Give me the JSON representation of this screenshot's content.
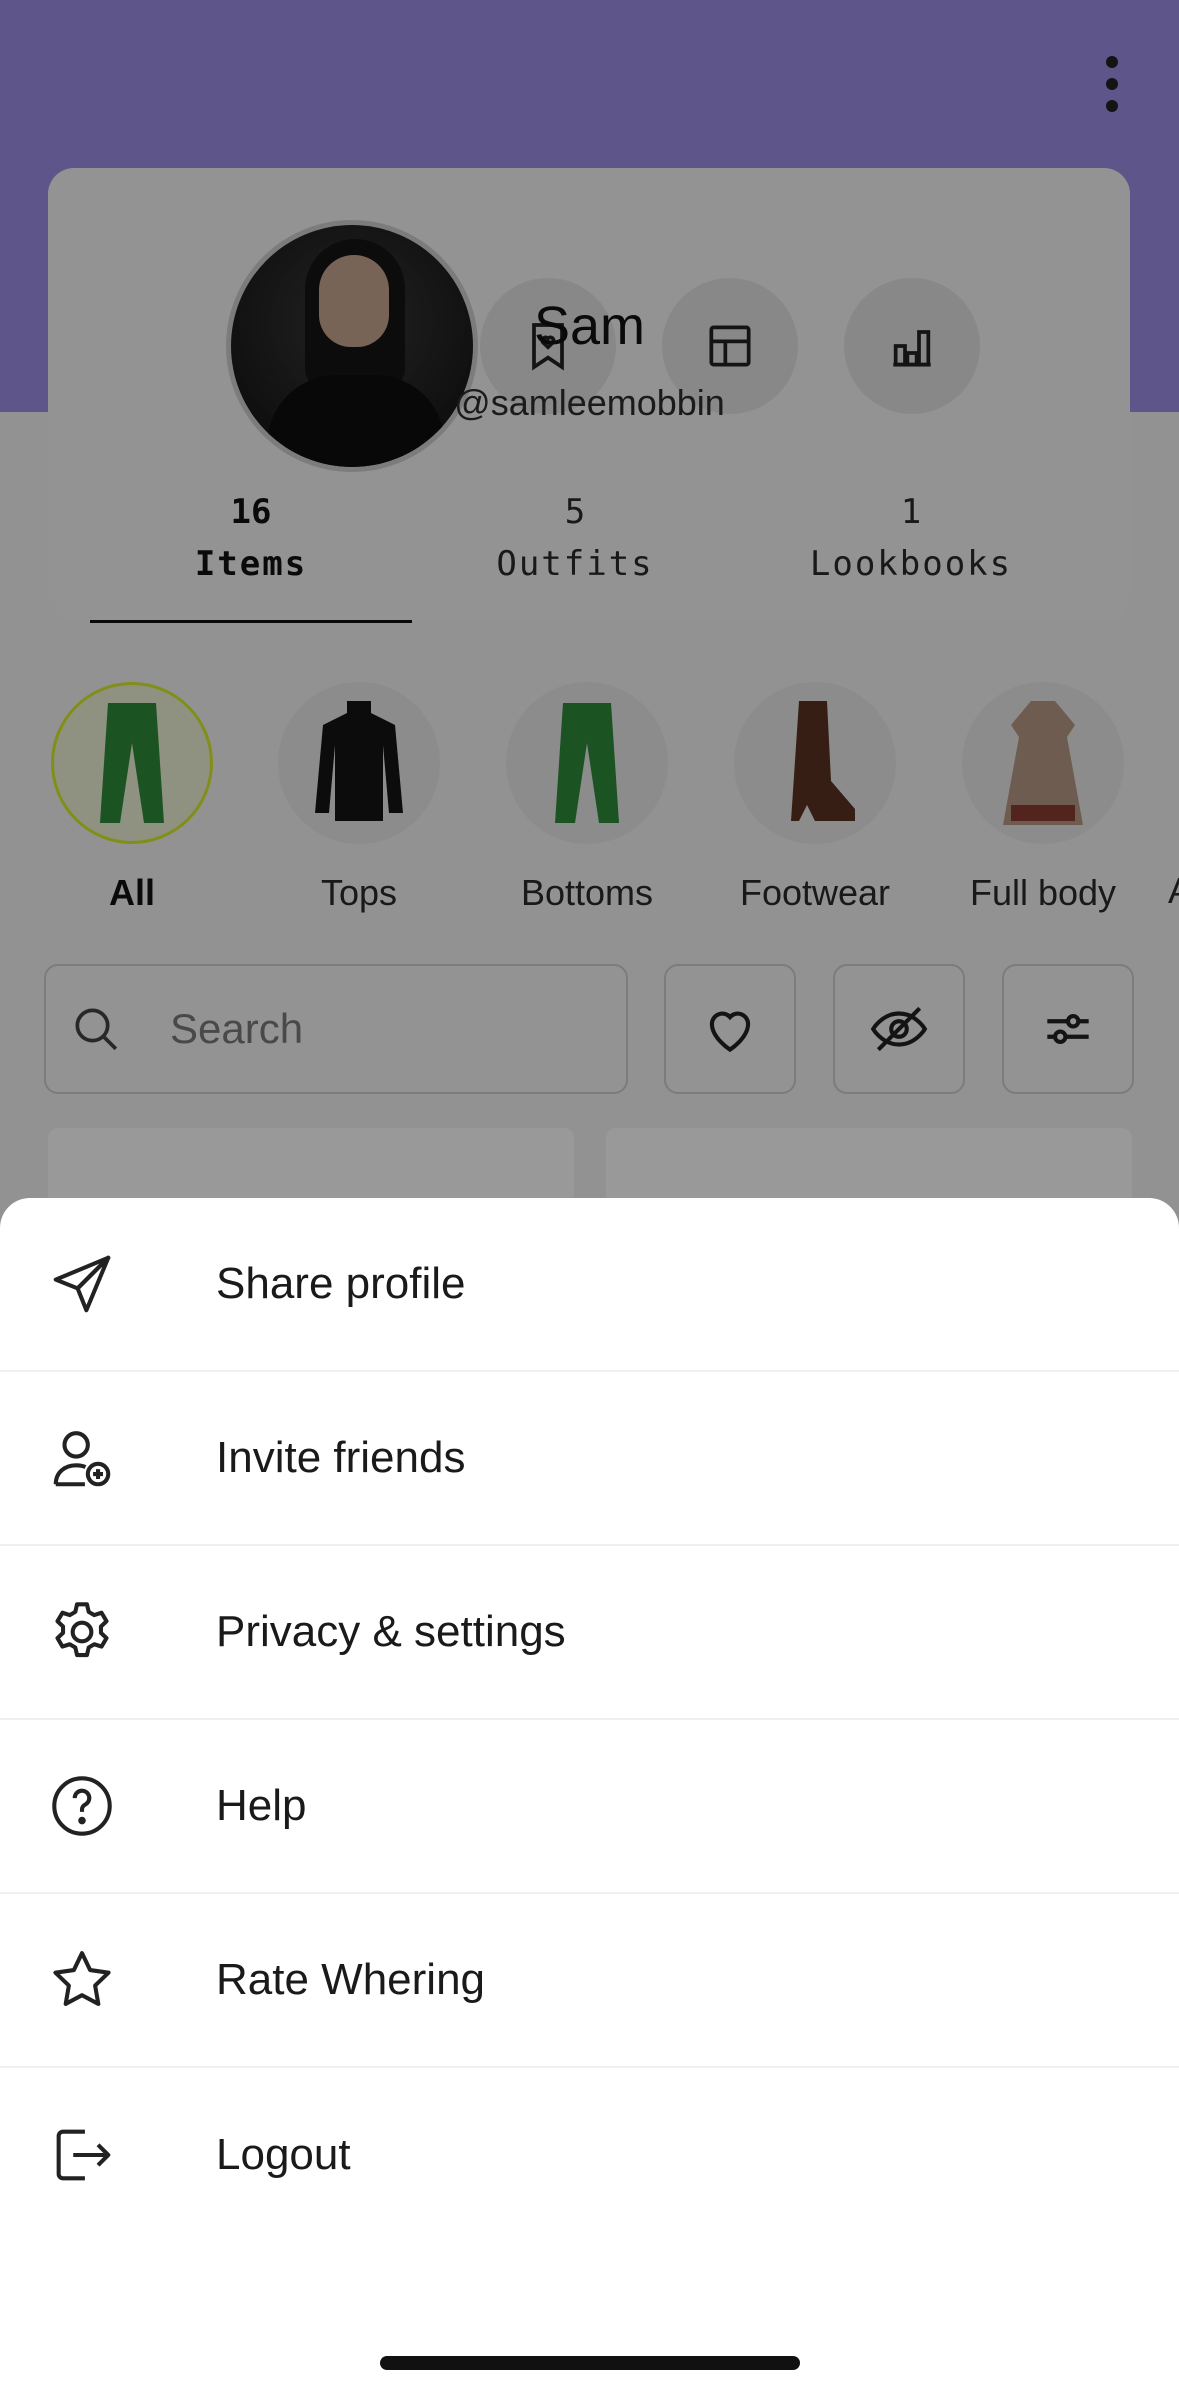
{
  "profile": {
    "name": "Sam",
    "handle": "@samleemobbin",
    "icons": [
      "bookmark-heart-icon",
      "layout-grid-icon",
      "bar-chart-icon",
      "more-vertical-icon"
    ]
  },
  "stats": [
    {
      "count": "16",
      "label": "Items",
      "active": true
    },
    {
      "count": "5",
      "label": "Outfits",
      "active": false
    },
    {
      "count": "1",
      "label": "Lookbooks",
      "active": false
    }
  ],
  "categories": [
    {
      "label": "All",
      "selected": true
    },
    {
      "label": "Tops",
      "selected": false
    },
    {
      "label": "Bottoms",
      "selected": false
    },
    {
      "label": "Footwear",
      "selected": false
    },
    {
      "label": "Full body",
      "selected": false
    },
    {
      "label": "A",
      "selected": false
    }
  ],
  "search": {
    "placeholder": "Search",
    "icons": [
      "search-icon",
      "heart-icon",
      "eye-off-icon",
      "sliders-icon"
    ]
  },
  "menu": {
    "items": [
      {
        "label": "Share profile",
        "icon": "send-icon"
      },
      {
        "label": "Invite friends",
        "icon": "user-plus-icon"
      },
      {
        "label": "Privacy & settings",
        "icon": "gear-icon"
      },
      {
        "label": "Help",
        "icon": "help-circle-icon"
      },
      {
        "label": "Rate Whering",
        "icon": "star-icon"
      },
      {
        "label": "Logout",
        "icon": "logout-icon"
      }
    ]
  },
  "colors": {
    "header": "#9d8ee6",
    "selected_ring": "#d8ef2a",
    "overlay": "rgba(0,0,0,0.40)",
    "sheet": "#ffffff"
  }
}
